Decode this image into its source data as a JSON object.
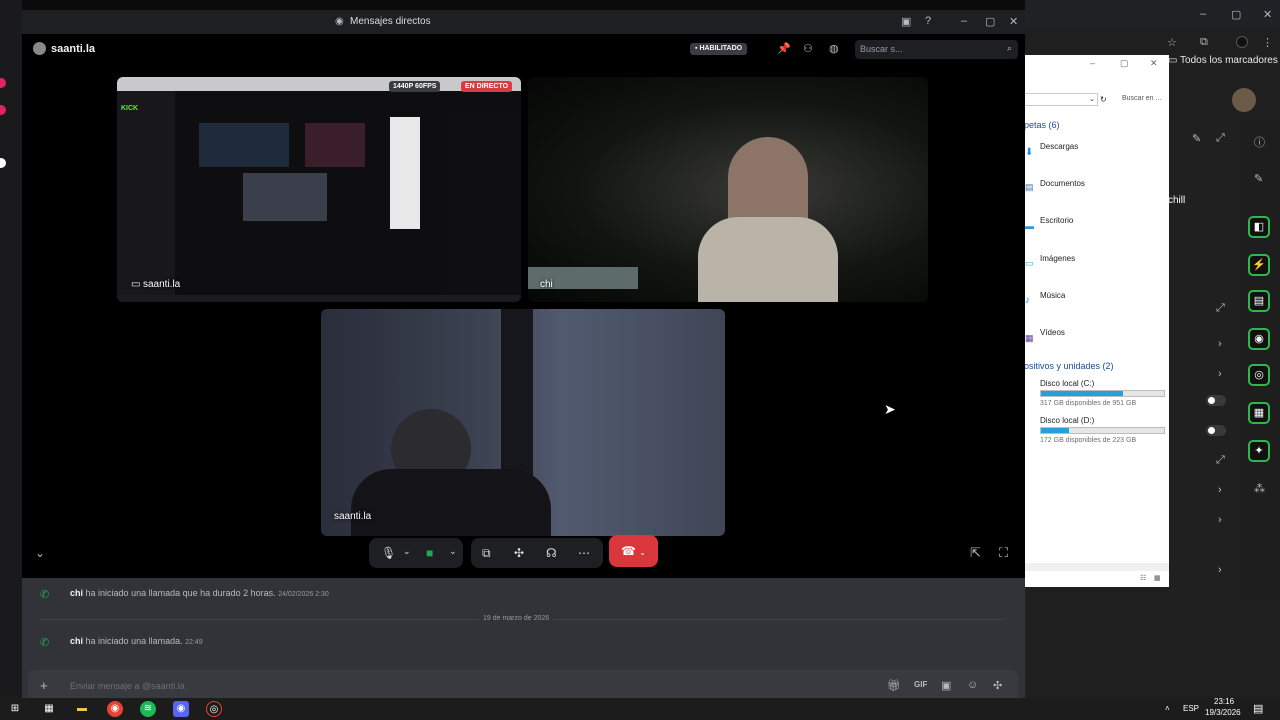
{
  "window": {
    "title": "Mensajes directos"
  },
  "dm": {
    "username": "saanti.la",
    "badge": "HABILITADO",
    "search_placeholder": "Buscar s..."
  },
  "tiles": {
    "screenshare_label": "saanti.la",
    "stream_quality": "1440P 60FPS",
    "stream_live": "EN DIRECTO",
    "chi_label": "chi",
    "saanti_label": "saanti.la"
  },
  "chat": {
    "msg1_user": "chi",
    "msg1_text": "ha iniciado una llamada que ha durado 2 horas.",
    "msg1_time": "24/02/2026 2:30",
    "divider": "19 de marzo de 2026",
    "msg2_user": "chi",
    "msg2_text": "ha iniciado una llamada.",
    "msg2_time": "22:49",
    "composer_placeholder": "Enviar mensaje a @saanti.la"
  },
  "explorer": {
    "folders_header": "petas (6)",
    "folders": [
      "Descargas",
      "Documentos",
      "Escritorio",
      "Imágenes",
      "Música",
      "Vídeos"
    ],
    "drives_header": "ositivos y unidades (2)",
    "drives": [
      {
        "name": "Disco local (C:)",
        "free": "317 GB disponibles de 951 GB",
        "used_fraction": 0.67
      },
      {
        "name": "Disco local (D:)",
        "free": "172 GB disponibles de 223 GB",
        "used_fraction": 0.23
      }
    ],
    "search_placeholder": "Buscar en ..."
  },
  "browser": {
    "bookmarks": "Todos los marcadores",
    "side_label": "chill"
  },
  "taskbar": {
    "lang": "ESP",
    "time": "23:16",
    "date": "19/3/2026"
  },
  "colors": {
    "discord_bg": "#000000",
    "chat_bg": "#313338",
    "end_call": "#da373c",
    "live_red": "#d83c3e",
    "green": "#23a55a"
  }
}
